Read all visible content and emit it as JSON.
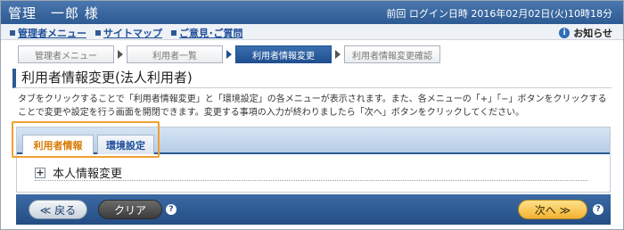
{
  "header": {
    "user_name": "管理　一郎 様",
    "last_login": "前回 ログイン日時 2016年02月02日(火)10時18分"
  },
  "nav": {
    "links": [
      "管理者メニュー",
      "サイトマップ",
      "ご意見･ご質問"
    ],
    "notice": "お知らせ"
  },
  "steps": [
    "管理者メニュー",
    "利用者一覧",
    "利用者情報変更",
    "利用者情報変更確認"
  ],
  "page": {
    "title": "利用者情報変更(法人利用者)",
    "description": "タブをクリックすることで「利用者情報変更」と「環境設定」の各メニューが表示されます。また、各メニューの「+」「−」ボタンをクリックすることで変更や設定を行う画面を開閉できます。変更する事項の入力が終わりましたら「次へ」ボタンをクリックしてください。"
  },
  "tabs": [
    "利用者情報",
    "環境設定"
  ],
  "section": {
    "toggle": "+",
    "label": "本人情報変更"
  },
  "buttons": {
    "back": "≪ 戻る",
    "clear": "クリア",
    "next": "次へ ≫",
    "help": "?"
  }
}
